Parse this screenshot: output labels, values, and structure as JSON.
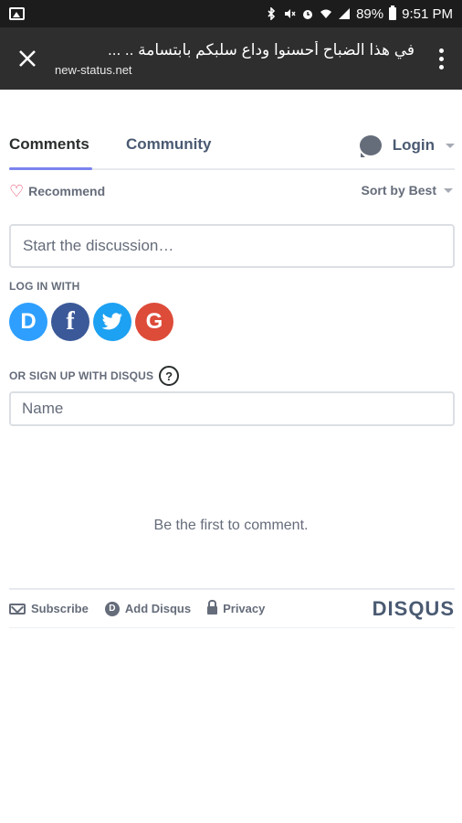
{
  "status_bar": {
    "battery": "89%",
    "time": "9:51 PM"
  },
  "toolbar": {
    "title": "في هذا الضباح أحسنوا وداع سلبكم بابتسامة .. ...",
    "url": "new-status.net"
  },
  "nav": {
    "tabs": [
      {
        "label": "Comments",
        "active": true
      },
      {
        "label": "Community",
        "active": false
      }
    ],
    "login_label": "Login"
  },
  "actions": {
    "recommend_label": "Recommend",
    "sort_label": "Sort by Best"
  },
  "discussion": {
    "placeholder": "Start the discussion…"
  },
  "login_with": {
    "label": "LOG IN WITH",
    "providers": [
      {
        "name": "disqus",
        "glyph": "D",
        "color": "#2e9fff"
      },
      {
        "name": "facebook",
        "glyph": "f",
        "color": "#3b5998"
      },
      {
        "name": "twitter",
        "glyph": "twitter-bird",
        "color": "#1da1f2"
      },
      {
        "name": "google",
        "glyph": "G",
        "color": "#dd4b39"
      }
    ]
  },
  "signup": {
    "label": "OR SIGN UP WITH DISQUS",
    "help_glyph": "?",
    "name_placeholder": "Name"
  },
  "empty_state": "Be the first to comment.",
  "footer": {
    "subscribe_label": "Subscribe",
    "add_disqus_label": "Add Disqus",
    "privacy_label": "Privacy",
    "brand": "DISQUS"
  },
  "colors": {
    "accent": "#7b83ee",
    "heart": "#e8456b"
  }
}
